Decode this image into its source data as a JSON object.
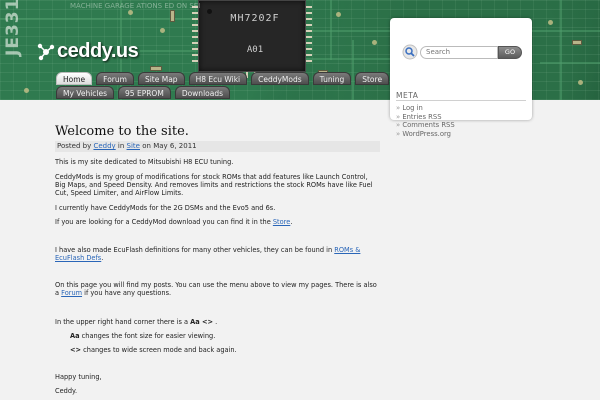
{
  "header": {
    "site_title": "ceddy.us",
    "silkscreen_top": "MACHINE     GARAGE ATIONS ED ON SEI",
    "silkscreen_side": "JE331",
    "chip_part": "MH7202F",
    "chip_code": "A01"
  },
  "nav": {
    "row1": [
      {
        "label": "Home",
        "active": true
      },
      {
        "label": "Forum",
        "active": false
      },
      {
        "label": "Site Map",
        "active": false
      },
      {
        "label": "H8 Ecu Wiki",
        "active": false
      },
      {
        "label": "CeddyMods",
        "active": false
      },
      {
        "label": "Tuning",
        "active": false
      },
      {
        "label": "Store",
        "active": false
      }
    ],
    "row2": [
      {
        "label": "My Vehicles",
        "active": false
      },
      {
        "label": "95 EPROM",
        "active": false
      },
      {
        "label": "Downloads",
        "active": false
      }
    ]
  },
  "sidebar": {
    "search": {
      "placeholder": "Search",
      "button": "GO"
    },
    "meta": {
      "title": "META",
      "items": [
        "Log in",
        "Entries RSS",
        "Comments RSS",
        "WordPress.org"
      ]
    }
  },
  "post": {
    "title": "Welcome to the site.",
    "meta": {
      "prefix": "Posted by",
      "author": "Ceddy",
      "in_word": "in",
      "category": "Site",
      "on_word": "on",
      "date": "May 6, 2011"
    },
    "paragraphs": {
      "p1": "This is my site dedicated to Mitsubishi H8 ECU tuning.",
      "p2": "CeddyMods is my group of modifications for stock ROMs that add features like Launch Control, Big Maps, and Speed Density.  And removes limits and restrictions the stock ROMs have like Fuel Cut, Speed Limiter, and AirFlow Limits.",
      "p3": "I currently have CeddyMods for the 2G DSMs and the Evo5 and 6s.",
      "p4_before": "If you are looking for a CeddyMod download you can find it in the ",
      "p4_link": "Store",
      "p4_after": ".",
      "p5_before": "I have also made EcuFlash definitions for many other vehicles, they can be found in ",
      "p5_link": "ROMs & EcuFlash Defs",
      "p5_after": ".",
      "p6_before": "On this page you will find my posts.  You can use the menu above to view my pages.  There is also a ",
      "p6_link": "Forum",
      "p6_after": " if you have any questions.",
      "p7_before": "In the upper right hand corner there is a ",
      "p7_bold": "Aa <>",
      "p7_after": " .",
      "p8_bold": "Aa",
      "p8_after": " changes the font size for easier viewing.",
      "p9_bold": "<>",
      "p9_after": " changes to wide screen mode and back again.",
      "p10": "Happy tuning,",
      "p11": "Ceddy."
    }
  },
  "colors": {
    "link": "#2a66b8",
    "board_green": "#1f5a3a",
    "tab_active": "#ffffff",
    "tab_inactive": "#5c5c5c"
  }
}
